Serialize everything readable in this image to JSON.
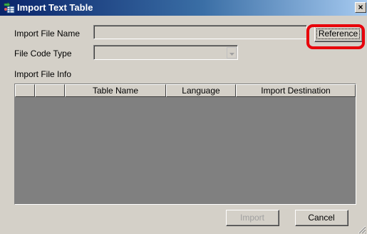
{
  "window": {
    "title": "Import Text Table",
    "close_symbol": "×"
  },
  "form": {
    "import_file_name_label": "Import File Name",
    "import_file_name_value": "",
    "reference_button": "Reference",
    "file_code_type_label": "File Code Type",
    "file_code_type_value": "",
    "import_file_info_label": "Import File Info"
  },
  "table": {
    "columns": [
      "",
      "",
      "Table Name",
      "Language",
      "Import Destination"
    ],
    "rows": []
  },
  "footer": {
    "import_button": "Import",
    "import_enabled": false,
    "cancel_button": "Cancel"
  },
  "colors": {
    "highlight": "#e8000a",
    "titlebar_start": "#0a246a",
    "titlebar_end": "#a6caf0",
    "grid_background": "#808080",
    "dialog_face": "#d4d0c8"
  },
  "icons": {
    "app": "import-table-icon",
    "close": "close-icon",
    "dropdown": "chevron-down-icon",
    "resize": "resize-grip-icon"
  }
}
